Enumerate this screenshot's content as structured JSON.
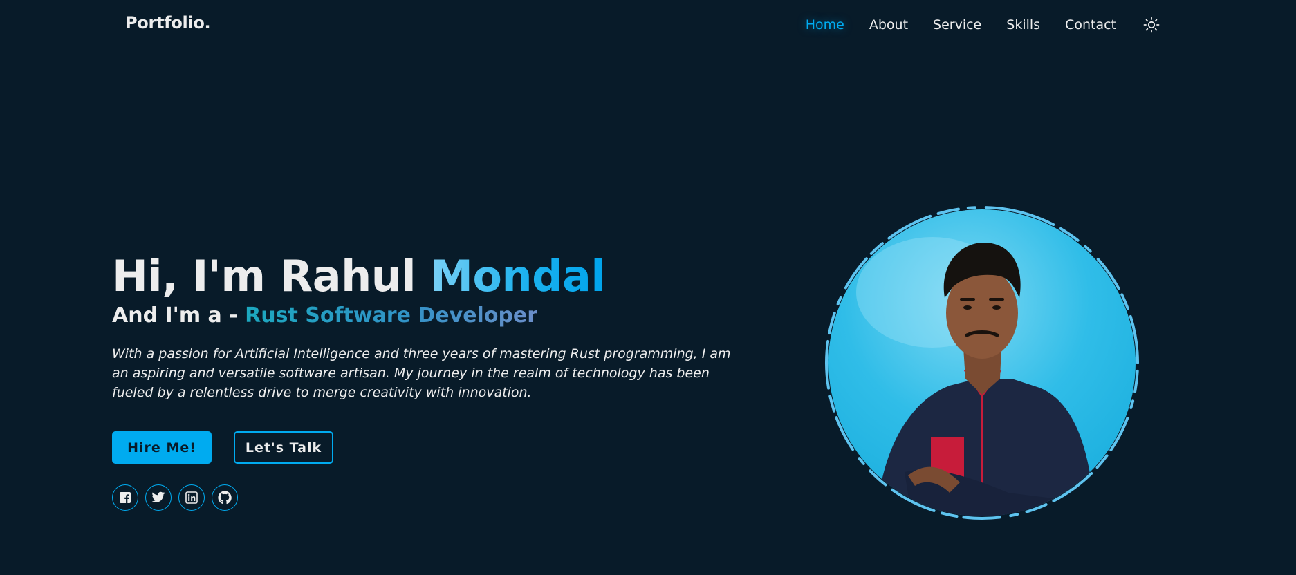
{
  "header": {
    "logo": "Portfolio.",
    "nav": [
      {
        "label": "Home",
        "active": true
      },
      {
        "label": "About"
      },
      {
        "label": "Service"
      },
      {
        "label": "Skills"
      },
      {
        "label": "Contact"
      }
    ],
    "theme_icon": "sun-icon"
  },
  "hero": {
    "greeting": "Hi, I'm Rahul ",
    "name_highlight": "Mondal",
    "subtitle_prefix": "And I'm a - ",
    "role": "Rust Software Developer",
    "description": "With a passion for Artificial Intelligence and three years of mastering Rust programming, I am an aspiring and versatile software artisan. My journey in the realm of technology has been fueled by a relentless drive to merge creativity with innovation.",
    "buttons": {
      "hire": "Hire Me!",
      "talk": "Let's Talk"
    },
    "social": [
      "facebook-icon",
      "twitter-icon",
      "linkedin-icon",
      "github-icon"
    ]
  },
  "profile": {
    "image": "portrait-photo"
  },
  "colors": {
    "background": "#081b29",
    "accent": "#00abf0",
    "text": "#ededed"
  }
}
